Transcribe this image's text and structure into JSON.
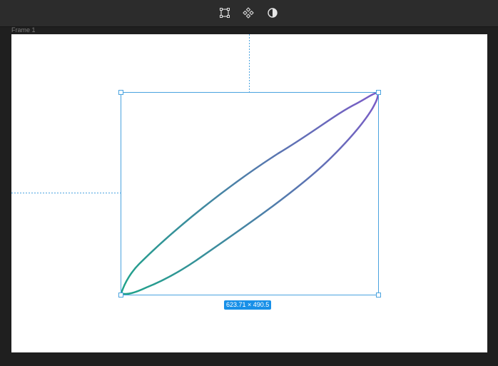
{
  "toolbar": {
    "tools": [
      {
        "name": "transform-icon"
      },
      {
        "name": "component-icon"
      },
      {
        "name": "contrast-icon"
      }
    ]
  },
  "frame": {
    "label": "Frame 1"
  },
  "selection": {
    "dimensions": "623.71 × 490.5"
  },
  "colors": {
    "selection": "#4aa3df",
    "badge": "#1890e8",
    "gradient_start": "#1fa38a",
    "gradient_end": "#7b5cc7"
  }
}
